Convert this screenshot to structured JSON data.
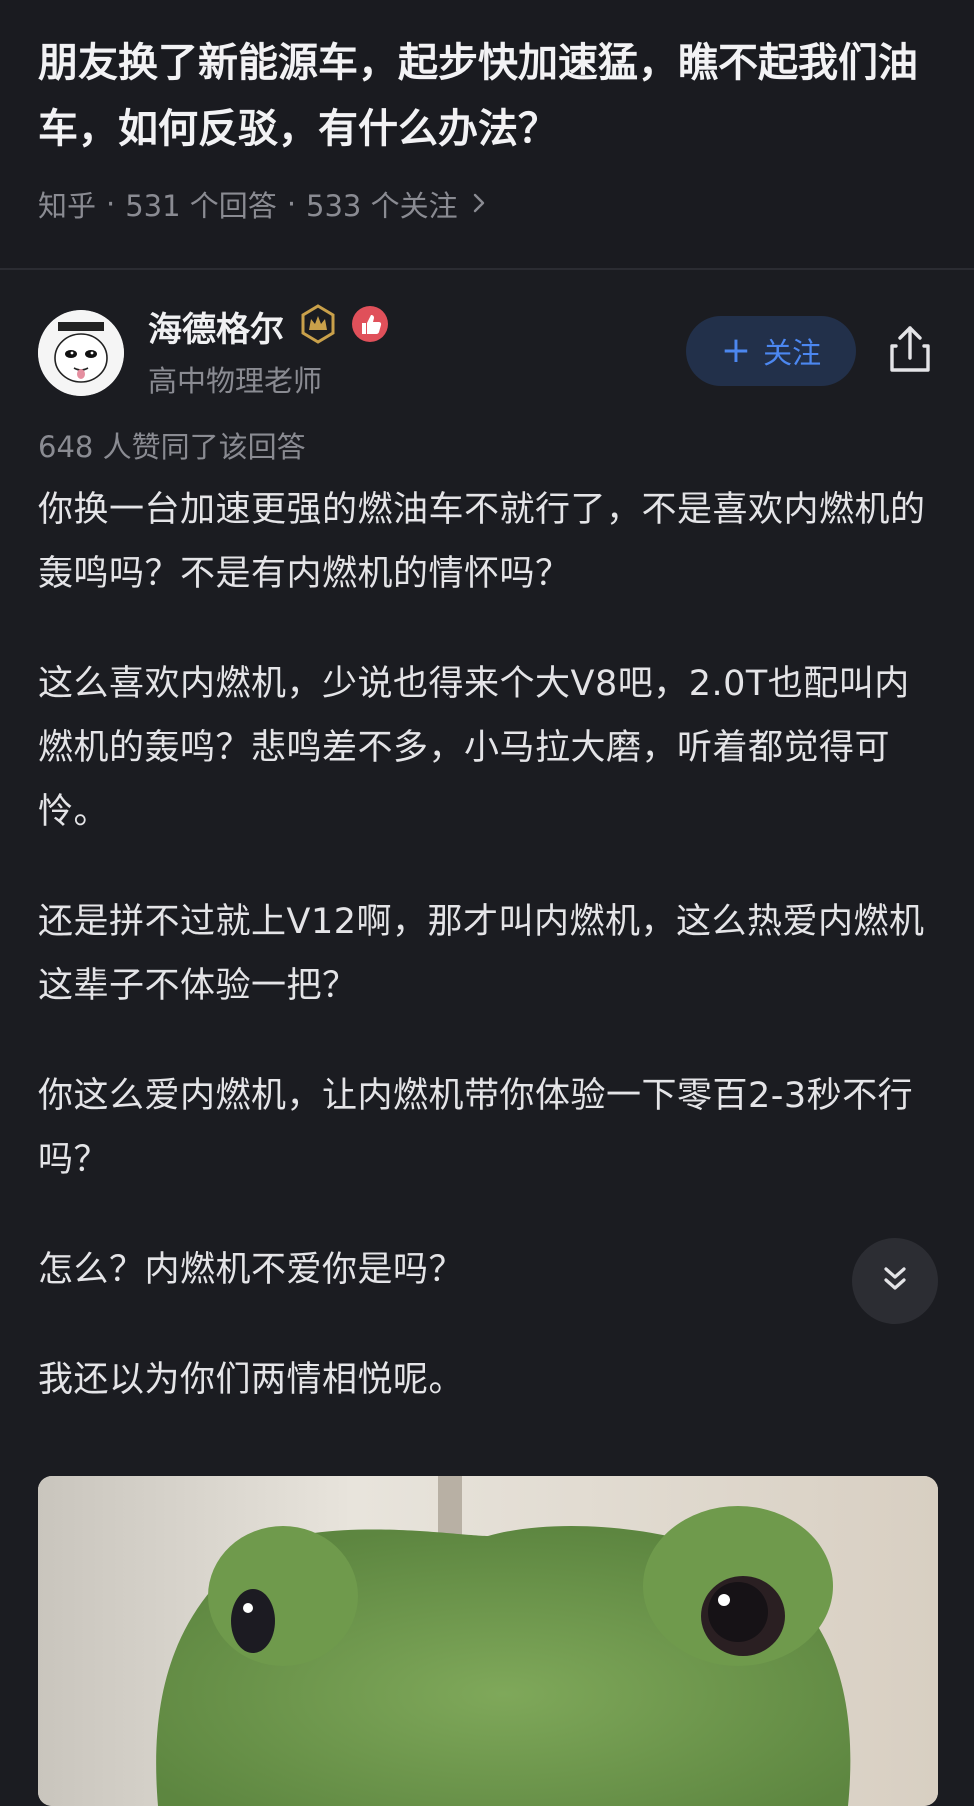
{
  "question": {
    "title": "朋友换了新能源车，起步快加速猛，瞧不起我们油车，如何反驳，有什么办法？",
    "source": "知乎",
    "answers_count": "531 个回答",
    "followers_count": "533 个关注",
    "separator": "·",
    "chevron_icon": "chevron-right-icon"
  },
  "author": {
    "name": "海德格尔",
    "bio": "高中物理老师",
    "avatar_icon": "avatar-cartoon",
    "badges": [
      "crown-badge-icon",
      "thumbs-up-badge-icon"
    ],
    "follow_label": "关注",
    "follow_plus": "+",
    "share_icon": "share-icon"
  },
  "answer": {
    "votes_text": "648 人赞同了该回答",
    "paragraphs": [
      "你换一台加速更强的燃油车不就行了，不是喜欢内燃机的轰鸣吗？不是有内燃机的情怀吗？",
      "这么喜欢内燃机，少说也得来个大V8吧，2.0T也配叫内燃机的轰鸣？悲鸣差不多，小马拉大磨，听着都觉得可怜。",
      "还是拼不过就上V12啊，那才叫内燃机，这么热爱内燃机这辈子不体验一把？",
      "你这么爱内燃机，让内燃机带你体验一下零百2-3秒不行吗？",
      "怎么？内燃机不爱你是吗？",
      "我还以为你们两情相悦呢。"
    ],
    "image_icon": "frog-plush-image",
    "scroll_icon": "double-chevron-down-icon"
  },
  "colors": {
    "background": "#1b1c21",
    "text": "#e4e4e7",
    "muted": "#8a8b92",
    "accent": "#4c87f0",
    "follow_bg": "#22304a",
    "badge_gold": "#c9a04a",
    "badge_red": "#e0505a"
  }
}
